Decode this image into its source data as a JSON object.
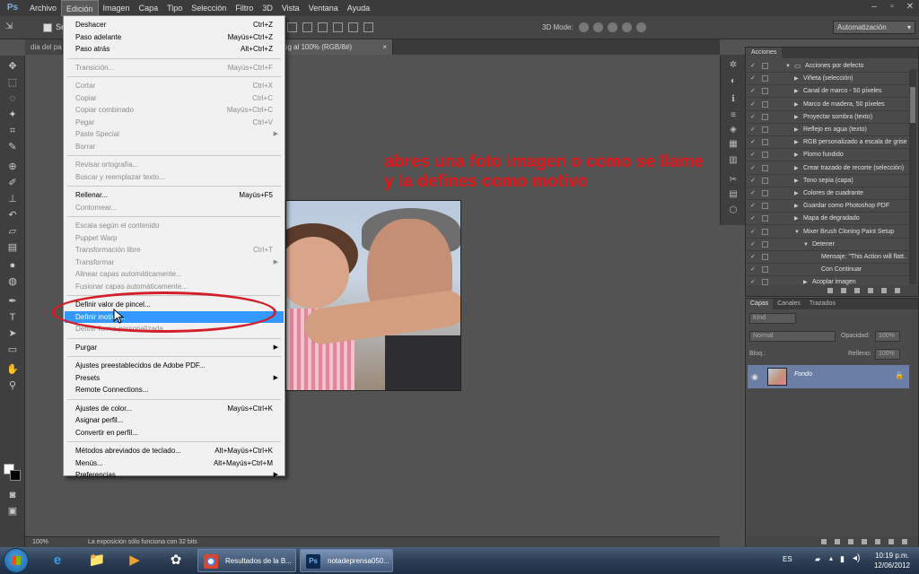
{
  "menubar": {
    "logo": "Ps",
    "items": [
      "Archivo",
      "Edición",
      "Imagen",
      "Capa",
      "Tipo",
      "Selección",
      "Filtro",
      "3D",
      "Vista",
      "Ventana",
      "Ayuda"
    ],
    "active": "Edición"
  },
  "window_controls": {
    "minimize": "‒",
    "maximize": "▫",
    "close": "✕"
  },
  "options_bar": {
    "tool_glyph": "⇲",
    "auto_select_label": "Se",
    "mode_3d_label": "3D Mode:",
    "workspace": "Automatización"
  },
  "tabs": [
    {
      "label": "dia del pa",
      "active": false
    },
    {
      "label": "pg al 100% (RGB/8#)",
      "active": true,
      "close": "×"
    }
  ],
  "annotation": {
    "line1": "abres una foto imagen o como se llame",
    "line2": "y la defines como motivo",
    "color": "#e0171b"
  },
  "edit_menu": {
    "items": [
      {
        "label": "Deshacer",
        "shortcut": "Ctrl+Z",
        "disabled": false
      },
      {
        "label": "Paso adelante",
        "shortcut": "Mayús+Ctrl+Z",
        "disabled": false
      },
      {
        "label": "Paso atrás",
        "shortcut": "Alt+Ctrl+Z",
        "disabled": false
      },
      {
        "sep": true
      },
      {
        "label": "Transición...",
        "shortcut": "Mayús+Ctrl+F",
        "disabled": true
      },
      {
        "sep": true
      },
      {
        "label": "Cortar",
        "shortcut": "Ctrl+X",
        "disabled": true
      },
      {
        "label": "Copiar",
        "shortcut": "Ctrl+C",
        "disabled": true
      },
      {
        "label": "Copiar combinado",
        "shortcut": "Mayús+Ctrl+C",
        "disabled": true
      },
      {
        "label": "Pegar",
        "shortcut": "Ctrl+V",
        "disabled": true
      },
      {
        "label": "Paste Special",
        "submenu": true,
        "disabled": true
      },
      {
        "label": "Borrar",
        "disabled": true
      },
      {
        "sep": true
      },
      {
        "label": "Revisar ortografía...",
        "disabled": true
      },
      {
        "label": "Buscar y reemplazar texto...",
        "disabled": true
      },
      {
        "sep": true
      },
      {
        "label": "Rellenar...",
        "shortcut": "Mayús+F5",
        "disabled": false
      },
      {
        "label": "Contornear...",
        "disabled": true
      },
      {
        "sep": true
      },
      {
        "label": "Escala según el contenido",
        "disabled": true
      },
      {
        "label": "Puppet Warp",
        "disabled": true
      },
      {
        "label": "Transformación libre",
        "shortcut": "Ctrl+T",
        "disabled": true
      },
      {
        "label": "Transformar",
        "submenu": true,
        "disabled": true
      },
      {
        "label": "Alinear capas automáticamente...",
        "disabled": true
      },
      {
        "label": "Fusionar capas automáticamente...",
        "disabled": true
      },
      {
        "sep": true
      },
      {
        "label": "Definir valor de pincel...",
        "disabled": false
      },
      {
        "label": "Definir motivo...",
        "disabled": false,
        "highlighted": true
      },
      {
        "label": "Definir forma personalizada...",
        "disabled": true
      },
      {
        "sep": true
      },
      {
        "label": "Purgar",
        "submenu": true,
        "disabled": false
      },
      {
        "sep": true
      },
      {
        "label": "Ajustes preestablecidos de Adobe PDF...",
        "disabled": false
      },
      {
        "label": "Presets",
        "submenu": true,
        "disabled": false
      },
      {
        "label": "Remote Connections...",
        "disabled": false
      },
      {
        "sep": true
      },
      {
        "label": "Ajustes de color...",
        "shortcut": "Mayús+Ctrl+K",
        "disabled": false
      },
      {
        "label": "Asignar perfil...",
        "disabled": false
      },
      {
        "label": "Convertir en perfil...",
        "disabled": false
      },
      {
        "sep": true
      },
      {
        "label": "Métodos abreviados de teclado...",
        "shortcut": "Alt+Mayús+Ctrl+K",
        "disabled": false
      },
      {
        "label": "Menús...",
        "shortcut": "Alt+Mayús+Ctrl+M",
        "disabled": false
      },
      {
        "label": "Preferencias",
        "submenu": true,
        "disabled": false
      }
    ]
  },
  "actions_panel": {
    "tab": "Acciones",
    "rows": [
      {
        "label": "Acciones por defecto",
        "level": 0,
        "expanded": true,
        "folder": true
      },
      {
        "label": "Viñeta (selección)",
        "level": 1
      },
      {
        "label": "Canal de marco - 50 píxeles",
        "level": 1
      },
      {
        "label": "Marco de madera, 50 píxeles",
        "level": 1
      },
      {
        "label": "Proyectar sombra (texto)",
        "level": 1
      },
      {
        "label": "Reflejo en agua (texto)",
        "level": 1
      },
      {
        "label": "RGB personalizado a escala de grises",
        "level": 1
      },
      {
        "label": "Plomo fundido",
        "level": 1
      },
      {
        "label": "Crear trazado de recorte (selección)",
        "level": 1
      },
      {
        "label": "Tono sepia (capa)",
        "level": 1
      },
      {
        "label": "Colores de cuadrante",
        "level": 1
      },
      {
        "label": "Guardar como Photoshop PDF",
        "level": 1
      },
      {
        "label": "Mapa de degradado",
        "level": 1
      },
      {
        "label": "Mixer Brush Cloning Paint Setup",
        "level": 1,
        "expanded": true
      },
      {
        "label": "Detener",
        "level": 2,
        "expanded": true
      },
      {
        "label": "Mensaje: \"This Action will flatt...",
        "level": 3
      },
      {
        "label": "Con Continuar",
        "level": 3
      },
      {
        "label": "Acoplar imagen",
        "level": 2
      }
    ]
  },
  "layers_panel": {
    "tabs": [
      "Capas",
      "Canales",
      "Trazados"
    ],
    "active_tab": "Capas",
    "filter": "Kind",
    "blend_mode": "Normal",
    "opacity_label": "Opacidad:",
    "opacity_value": "100%",
    "lock_label": "Bloq.:",
    "fill_label": "Relleno:",
    "fill_value": "100%",
    "layer_name": "Fondo"
  },
  "status_bar": {
    "zoom": "100%",
    "message": "La exposición sólo funciona con 32 bits"
  },
  "taskbar": {
    "pins": [
      "e",
      "📁",
      "▶",
      "✿"
    ],
    "windows": [
      {
        "label": "Resultados de la B...",
        "icon_color": "#d9452f"
      },
      {
        "label": "notadeprensa050...",
        "icon_color": "#0a2a4f"
      }
    ],
    "lang": "ES",
    "time": "10:19 p.m.",
    "date": "12/06/2012"
  }
}
